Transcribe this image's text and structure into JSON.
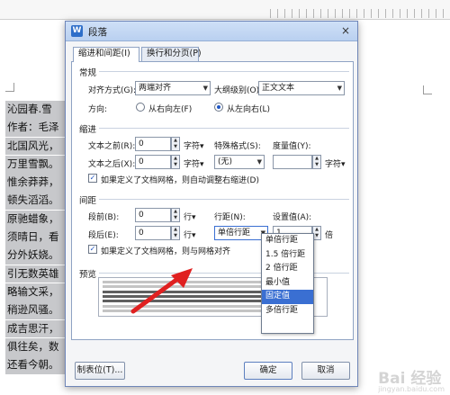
{
  "document": {
    "lines": [
      "沁园春.雪",
      "作者：毛泽",
      "北国风光，",
      "万里雪飘。",
      "惟余莽莽，",
      "顿失滔滔。",
      "原驰蜡象，",
      "须晴日，看",
      "分外妖娆。",
      "引无数英雄",
      "略输文采，",
      "稍逊风骚。",
      "成吉思汗，",
      "俱往矣，数",
      "还看今朝。"
    ]
  },
  "dialog": {
    "title": "段落",
    "close_glyph": "×",
    "tabs": [
      {
        "label": "缩进和间距(I)",
        "active": true
      },
      {
        "label": "换行和分页(P)",
        "active": false
      }
    ],
    "general": {
      "title": "常规",
      "alignment_label": "对齐方式(G):",
      "alignment_value": "两端对齐",
      "outline_label": "大纲级别(O):",
      "outline_value": "正文文本",
      "direction_label": "方向:",
      "rtl_label": "从右向左(F)",
      "ltr_label": "从左向右(L)"
    },
    "indent": {
      "title": "缩进",
      "before_label": "文本之前(R):",
      "before_value": "0",
      "before_unit": "字符▾",
      "special_label": "特殊格式(S):",
      "special_value": "(无)",
      "measure_label": "度量值(Y):",
      "measure_value": "",
      "measure_unit": "字符▾",
      "after_label": "文本之后(X):",
      "after_value": "0",
      "after_unit": "字符▾",
      "grid_check_label": "如果定义了文档网格，则自动调整右缩进(D)"
    },
    "spacing": {
      "title": "间距",
      "before_label": "段前(B):",
      "before_value": "0",
      "before_unit": "行▾",
      "line_spacing_label": "行距(N):",
      "line_spacing_value": "单倍行距",
      "at_label": "设置值(A):",
      "at_value": "1",
      "at_unit": "倍",
      "after_label": "段后(E):",
      "after_value": "0",
      "after_unit": "行▾",
      "grid_check_label": "如果定义了文档网格，则与网格对齐"
    },
    "line_spacing_options": [
      "单倍行距",
      "1.5 倍行距",
      "2 倍行距",
      "最小值",
      "固定值",
      "多倍行距"
    ],
    "line_spacing_highlighted": "固定值",
    "preview": {
      "title": "预览"
    },
    "buttons": {
      "tabs": "制表位(T)...",
      "ok": "确定",
      "cancel": "取消"
    }
  },
  "watermark": {
    "text": "Bai 经验",
    "sub": "jingyan.baidu.com"
  },
  "colors": {
    "highlight": "#3a6fd2",
    "arrow": "#e02020"
  }
}
